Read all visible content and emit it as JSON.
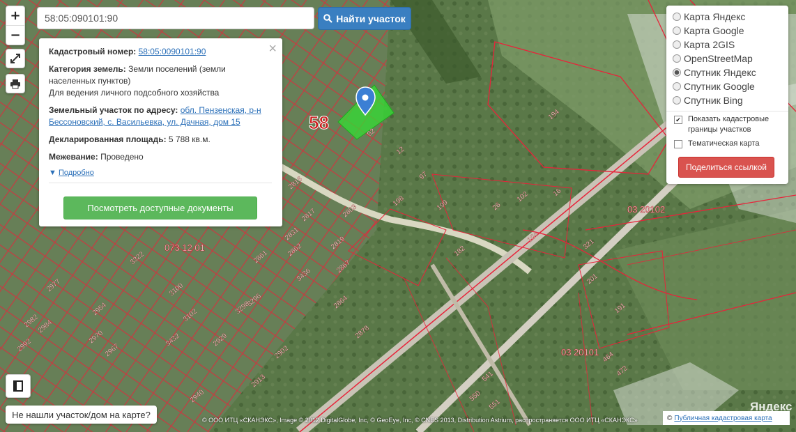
{
  "search": {
    "value": "58:05:090101:90",
    "button_label": "Найти участок"
  },
  "controls": {
    "zoom_in": "+",
    "zoom_out": "−"
  },
  "popup": {
    "cadnum_label": "Кадастровый номер:",
    "cadnum_value": "58:05:0090101:90",
    "category_label": "Категория земель:",
    "category_value": "Земли поселений (земли населенных пунктов)",
    "usage": "Для ведения личного подсобного хозяйства",
    "address_label": "Земельный участок по адресу:",
    "address_value": "обл. Пензенская, р-н Бессоновский, с. Васильевка, ул. Дачная, дом 15",
    "area_label": "Декларированная площадь:",
    "area_value": "5 788 кв.м.",
    "survey_label": "Межевание:",
    "survey_value": "Проведено",
    "more_link": "Подробно",
    "docs_button": "Посмотреть доступные документы"
  },
  "layers": {
    "options": [
      {
        "label": "Карта Яндекс",
        "selected": false
      },
      {
        "label": "Карта Google",
        "selected": false
      },
      {
        "label": "Карта 2GIS",
        "selected": false
      },
      {
        "label": "OpenStreetMap",
        "selected": false
      },
      {
        "label": "Спутник Яндекс",
        "selected": true
      },
      {
        "label": "Спутник Google",
        "selected": false
      },
      {
        "label": "Спутник Bing",
        "selected": false
      }
    ],
    "show_borders": "Показать кадастровые границы участков",
    "show_borders_checked": true,
    "thematic": "Тематическая карта",
    "thematic_checked": false,
    "share_button": "Поделиться ссылкой"
  },
  "map": {
    "region_label": "58",
    "quarter_labels": [
      "073 12 01",
      "03 20102",
      "03 20101"
    ],
    "parcel_labels": [
      "194",
      "182",
      "92",
      "12",
      "97",
      "198",
      "199",
      "26",
      "102",
      "16",
      "104",
      "321",
      "201",
      "191",
      "2803",
      "2816",
      "2817",
      "2819",
      "2831",
      "2861",
      "2862",
      "2864",
      "2867",
      "2878",
      "2902",
      "2929",
      "3298",
      "3296",
      "3100",
      "3102",
      "2913",
      "2940",
      "2954",
      "2977",
      "2982",
      "2984",
      "2992",
      "2970",
      "2967",
      "3432",
      "3436",
      "3322",
      "464",
      "472",
      "541",
      "550",
      "551"
    ],
    "colors": {
      "border": "#e8233a",
      "selected": "#33dd33"
    }
  },
  "footer": {
    "not_found": "Не нашли участок/дом на карте?",
    "credits": "© ООО ИТЦ «СКАНЭКС», Image © 2012 DigitalGlobe, Inc, © GeoEye, Inc, © CNES 2013, Distribution Astrium, распространяется ООО ИТЦ «СКАНЭКС»",
    "pkk_link": "Публичная кадастровая карта",
    "yandex_logo": "Яндекс"
  }
}
